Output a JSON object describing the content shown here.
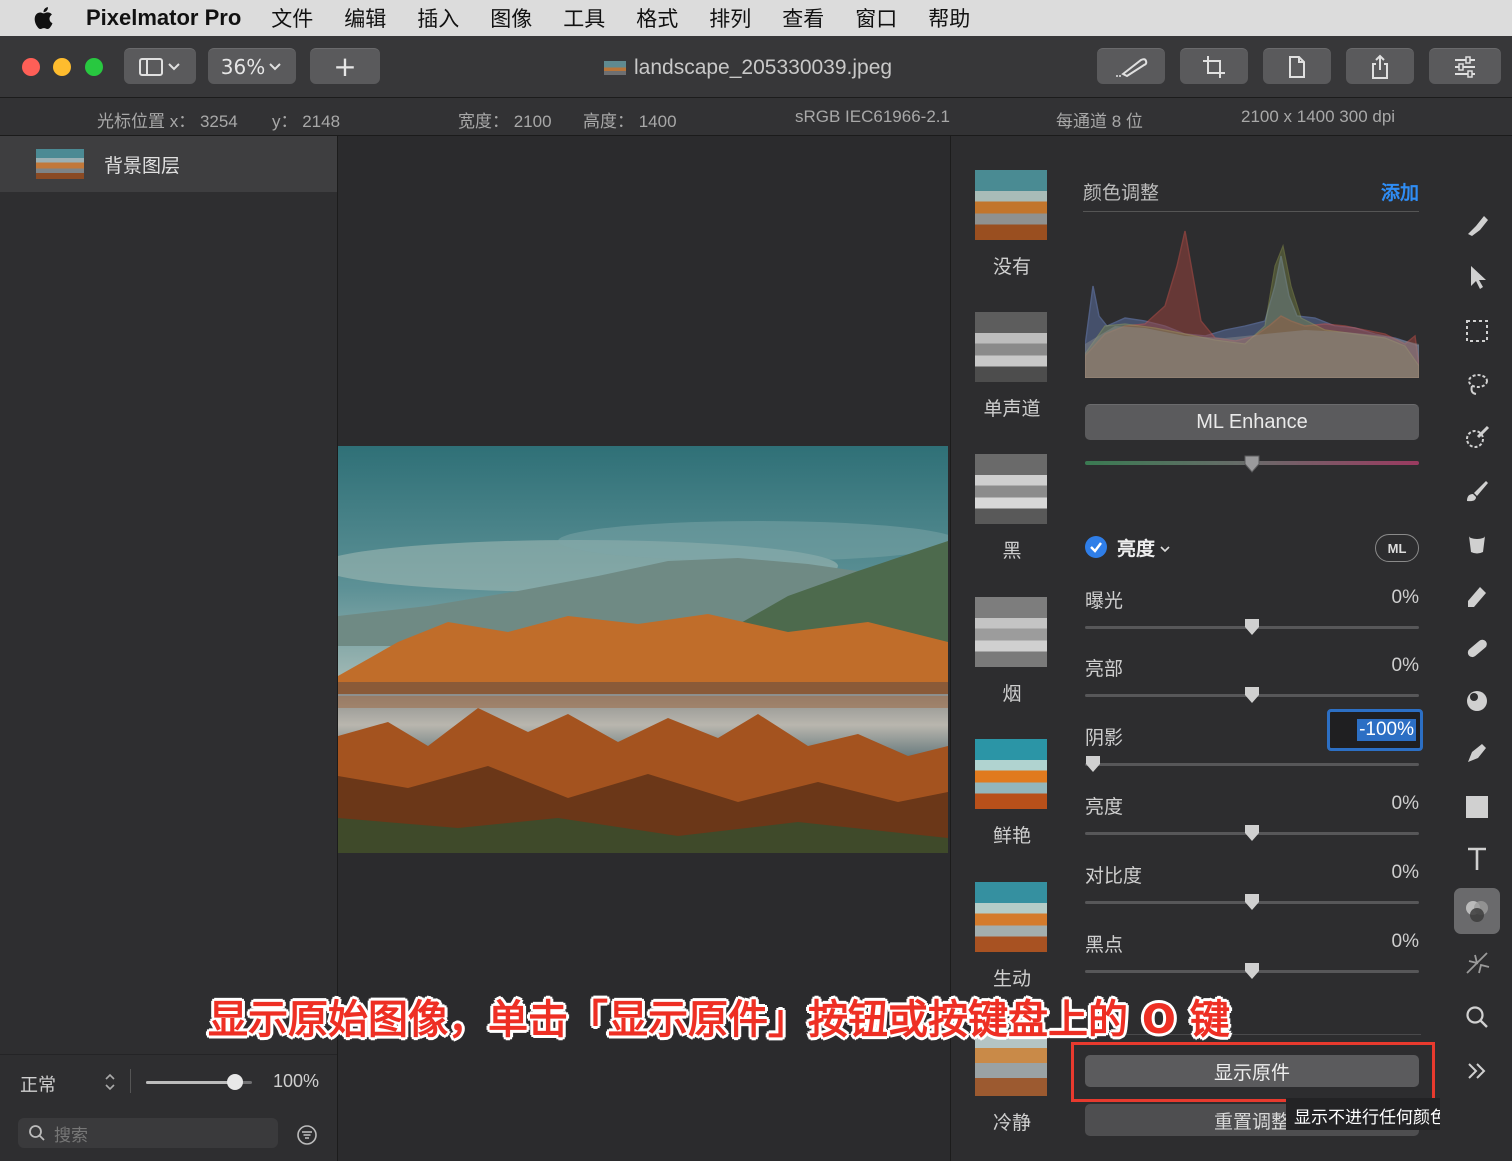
{
  "menubar": {
    "app_name": "Pixelmator Pro",
    "items": [
      "文件",
      "编辑",
      "插入",
      "图像",
      "工具",
      "格式",
      "排列",
      "查看",
      "窗口",
      "帮助"
    ]
  },
  "toolbar": {
    "zoom": "36%",
    "add": "+",
    "document_title": "landscape_205330039.jpeg"
  },
  "infobar": {
    "cursor_x": "光标位置 x： 3254",
    "cursor_y": "y： 2148",
    "width": "宽度： 2100",
    "height": "高度： 1400",
    "profile": "sRGB IEC61966-2.1",
    "depth": "每通道 8 位",
    "size": "2100 x 1400 300 dpi"
  },
  "layers": {
    "items": [
      {
        "name": "背景图层"
      }
    ],
    "blend_mode": "正常",
    "opacity": "100%",
    "opacity_fraction": 0.9,
    "search_placeholder": "搜索"
  },
  "presets": [
    "没有",
    "单声道",
    "黑",
    "烟",
    "鲜艳",
    "生动",
    "冷静"
  ],
  "color_adjust": {
    "title": "颜色调整",
    "add": "添加",
    "ml_enhance": "ML Enhance",
    "intensity_fraction": 0.5,
    "light": {
      "title": "亮度",
      "ml_badge": "ML",
      "sliders": [
        {
          "label": "曝光",
          "value": "0%",
          "fraction": 0.5
        },
        {
          "label": "亮部",
          "value": "0%",
          "fraction": 0.5
        },
        {
          "label": "阴影",
          "value": "-100%",
          "fraction": 0.0
        },
        {
          "label": "亮度",
          "value": "0%",
          "fraction": 0.5
        },
        {
          "label": "对比度",
          "value": "0%",
          "fraction": 0.5
        },
        {
          "label": "黑点",
          "value": "0%",
          "fraction": 0.5
        }
      ]
    },
    "show_original": "显示原件",
    "reset": "重置调整",
    "tooltip": "显示不进行任何颜色调整的"
  },
  "caption": "显示原始图像，单击「显示原件」按钮或按键盘上的 O 键",
  "colors": {
    "accent": "#2f8df5",
    "highlight_box": "#e83a2e",
    "caption": "#ee2f24"
  }
}
